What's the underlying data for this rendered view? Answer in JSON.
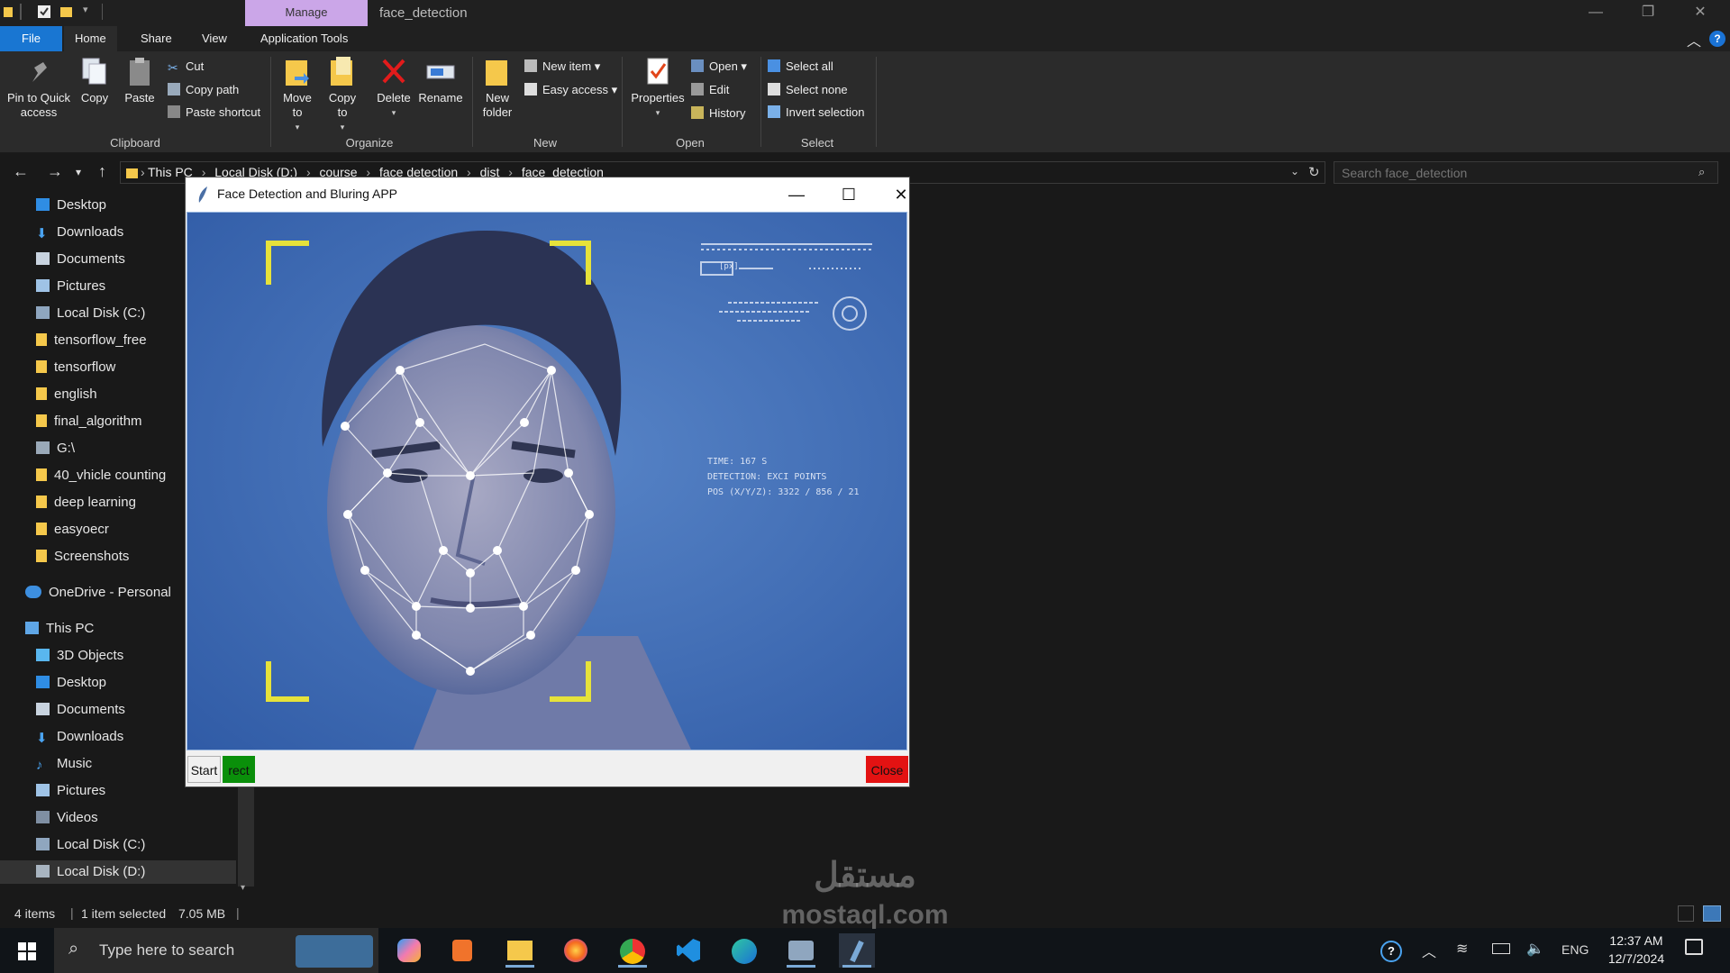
{
  "window": {
    "manage_tab": "Manage",
    "title": "face_detection"
  },
  "ribbon_tabs": [
    "File",
    "Home",
    "Share",
    "View",
    "Application Tools"
  ],
  "ribbon": {
    "clipboard": {
      "pin": "Pin to Quick access",
      "copy": "Copy",
      "paste": "Paste",
      "cut": "Cut",
      "copy_path": "Copy path",
      "paste_shortcut": "Paste shortcut",
      "label": "Clipboard"
    },
    "organize": {
      "move_to": "Move to",
      "copy_to": "Copy to",
      "delete": "Delete",
      "rename": "Rename",
      "label": "Organize"
    },
    "new": {
      "new_folder": "New folder",
      "new_item": "New item",
      "easy_access": "Easy access",
      "label": "New"
    },
    "open": {
      "properties": "Properties",
      "open": "Open",
      "edit": "Edit",
      "history": "History",
      "label": "Open"
    },
    "select": {
      "select_all": "Select all",
      "select_none": "Select none",
      "invert": "Invert selection",
      "label": "Select"
    }
  },
  "address": {
    "crumbs": [
      "This PC",
      "Local Disk (D:)",
      "course",
      "face detection",
      "dist",
      "face_detection"
    ],
    "search_placeholder": "Search face_detection"
  },
  "nav": {
    "quick": [
      "Desktop",
      "Downloads",
      "Documents",
      "Pictures",
      "Local Disk (C:)",
      "tensorflow_free",
      "tensorflow",
      "english",
      "final_algorithm",
      "G:\\",
      "40_vhicle counting",
      "deep learning",
      "easyoecr",
      "Screenshots"
    ],
    "onedrive": "OneDrive - Personal",
    "this_pc": "This PC",
    "pc_items": [
      "3D Objects",
      "Desktop",
      "Documents",
      "Downloads",
      "Music",
      "Pictures",
      "Videos",
      "Local Disk (C:)",
      "Local Disk (D:)"
    ]
  },
  "status": {
    "items": "4 items",
    "selected": "1 item selected",
    "size": "7.05 MB"
  },
  "app": {
    "title": "Face Detection and Bluring APP",
    "start_label": "Start",
    "rect_label": "rect",
    "close_label": "Close",
    "hud_lines": [
      "TIME: 167 S",
      "DETECTION: EXCI POINTS",
      "POS (X/Y/Z): 3322 / 856 / 21"
    ],
    "hud_label": "[px]"
  },
  "taskbar": {
    "search_placeholder": "Type here to search",
    "lang": "ENG",
    "time": "12:37 AM",
    "date": "12/7/2024"
  },
  "watermark": {
    "arabic": "مستقل",
    "latin": "mostaql.com"
  },
  "colors": {
    "accent": "#1976d2",
    "manage_tab": "#cba6e8",
    "rect_button": "#0a8f0a",
    "close_button": "#e31212",
    "photo_bg": "#3c6cb6",
    "corner_brackets": "#e6e23a"
  }
}
